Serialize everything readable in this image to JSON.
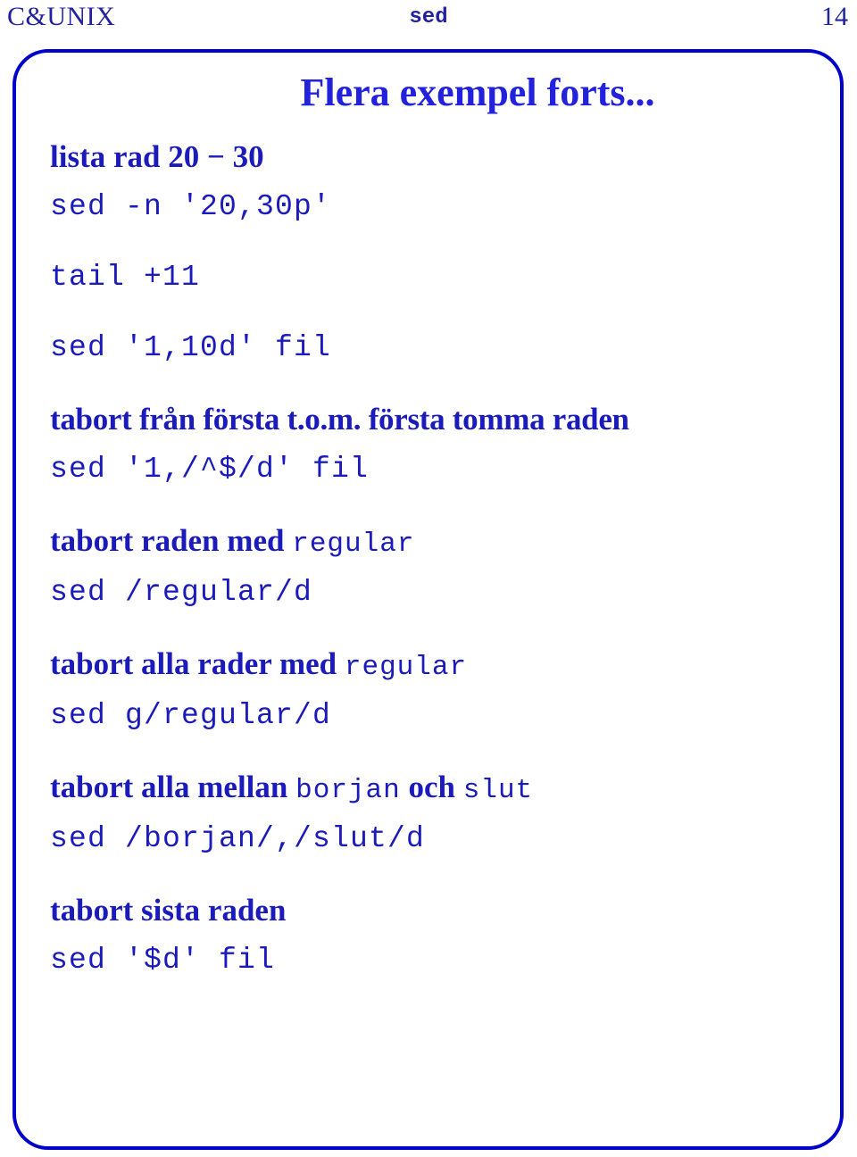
{
  "header": {
    "left_label": "C&UNIX",
    "center_label": "sed",
    "page_number": "14"
  },
  "slide": {
    "title": "Flera exempel forts...",
    "frame_color": "#0000cc",
    "text_color": "#1b1bbb",
    "title_color": "#2222dd",
    "header_color": "#22229c"
  },
  "body": {
    "lines": [
      {
        "kind": "desc",
        "text": "lista rad 20 − 30"
      },
      {
        "kind": "code",
        "text": "sed -n '20,30p'"
      },
      {
        "kind": "code",
        "text": "tail +11"
      },
      {
        "kind": "code",
        "text": "sed '1,10d' fil"
      },
      {
        "kind": "desc",
        "text": "tabort från första t.o.m. första tomma raden"
      },
      {
        "kind": "code",
        "text": "sed '1,/^$/d' fil"
      },
      {
        "kind": "mixed",
        "part_a": "tabort raden med ",
        "part_b": "regular"
      },
      {
        "kind": "code",
        "text": "sed /regular/d"
      },
      {
        "kind": "mixed",
        "part_a": "tabort alla rader med ",
        "part_b": "regular"
      },
      {
        "kind": "code",
        "text": "sed g/regular/d"
      },
      {
        "kind": "mixed4",
        "part_a": "tabort alla mellan ",
        "part_b": "borjan",
        "part_c": " och ",
        "part_d": "slut"
      },
      {
        "kind": "code",
        "text": "sed /borjan/,/slut/d"
      },
      {
        "kind": "desc",
        "text": "tabort sista raden"
      },
      {
        "kind": "code",
        "text": "sed '$d' fil"
      }
    ]
  }
}
